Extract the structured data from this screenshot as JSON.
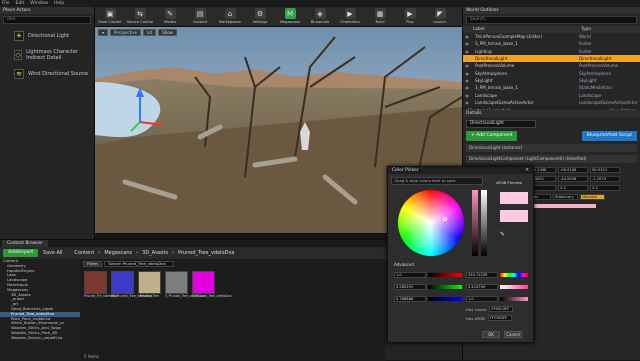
{
  "menu": {
    "file": "File",
    "edit": "Edit",
    "window": "Window",
    "help": "Help"
  },
  "place_actors": {
    "title": "Place Actors",
    "search_placeholder": "dire",
    "items": [
      "Directional Light",
      "Lightmass Character Indirect Detail",
      "Wind Directional Source"
    ]
  },
  "toolbar": {
    "items": [
      "Save Current",
      "Source Control",
      "Modes",
      "Content",
      "Marketplace",
      "Settings",
      "Megascans",
      "Blueprints",
      "Cinematics",
      "Build",
      "Play",
      "Launch"
    ]
  },
  "viewport": {
    "perspective": "Perspective",
    "lit": "Lit",
    "show": "Show"
  },
  "outliner": {
    "title": "World Outliner",
    "search_placeholder": "Search...",
    "col_label": "Label",
    "col_type": "Type",
    "rows": [
      {
        "label": "ThirdPersonExampleMap (Editor)",
        "type": "World",
        "selected": false
      },
      {
        "label": "3_PM_terrain_base_1",
        "type": "Folder",
        "selected": false
      },
      {
        "label": "Lighting",
        "type": "Folder",
        "selected": false
      },
      {
        "label": "DirectionalLight",
        "type": "DirectionalLight",
        "selected": true
      },
      {
        "label": "PostProcessVolume",
        "type": "PostProcessVolume",
        "selected": false
      },
      {
        "label": "SkyAtmosphere",
        "type": "SkyAtmosphere",
        "selected": false
      },
      {
        "label": "SkyLight",
        "type": "SkyLight",
        "selected": false
      },
      {
        "label": "3_PM_terrain_base_1",
        "type": "StaticMeshActor",
        "selected": false
      },
      {
        "label": "Landscape",
        "type": "Landscape",
        "selected": false
      },
      {
        "label": "LandscapeGizmoActiveActor",
        "type": "LandscapeGizmoActiveActor",
        "selected": false
      }
    ],
    "footer_count": "33 actors (1 selected)",
    "view_options": "View Options"
  },
  "details": {
    "title": "Details",
    "actor_name": "DirectionalLight",
    "add_component": "+ Add Component",
    "blueprint_btn": "Blueprint/Add Script",
    "component": "DirectionalLight (Instance)",
    "component2": "DirectionalLightComponent (LightComponent0) (Inherited)",
    "location": [
      "-304.2348",
      "-96.9146",
      "90.9124"
    ],
    "rotation": [
      "-66.6851",
      "-44.5946",
      "-1.2079"
    ],
    "scale": [
      "2.5",
      "2.5",
      "2.5"
    ],
    "mobility": [
      "Static",
      "Stationary",
      "Movable"
    ]
  },
  "content_browser": {
    "tab": "Content Browser",
    "add_new": "Add/Import",
    "save_all": "Save All",
    "path": [
      "Content",
      "Megascans",
      "3D_Assets",
      "Pruned_Tree_vdeloDva"
    ],
    "filters": "Filters",
    "search_placeholder": "Search Pruned_Tree_vdeloDva",
    "tree": [
      "Content",
      "Geometry",
      "HoudiniEngine",
      "Labs",
      "Landscape",
      "Mannequin",
      "Megascans",
      "3D_Assets",
      "_arood",
      "_art",
      "Dead_Branches_vlpeb",
      "Pruned_Tree_vdeloDva",
      "Rock_Pack_rcqbbt1w",
      "White_Button_Mushroom_pi",
      "Wooden_Sticks_And_Twigs",
      "Wooden_Sticks_Pack_4B",
      "Wooden_Branch_uepbfh1w"
    ],
    "assets": [
      {
        "name": "Pruned_Tre_vdeloDva",
        "color": "#7a3a32"
      },
      {
        "name": "MI_Pruned_Tree_vdeloDva",
        "color": "#3b3ac9"
      },
      {
        "name": "Pruned_Tree",
        "color": "#bfb08a"
      },
      {
        "name": "S_Pruned_Tree_vdeloDva",
        "color": "#7a7f7c"
      },
      {
        "name": "T_Pruned_Tree_vdeloDva",
        "color": "#e000e0"
      }
    ],
    "items_count": "5 items"
  },
  "color_picker": {
    "title": "Color Picker",
    "hint": "Drag & drop colors here to save",
    "srgb_preview": "sRGB Preview",
    "old": "Old",
    "new": "New",
    "advanced": "Advanced",
    "r": "1.0",
    "g": "0.585291",
    "b": "0.768886",
    "h": "334.72239",
    "s": "0.414709",
    "v": "1.0",
    "hex_linear_label": "Hex Linear",
    "hex_linear": "FF95C4FF",
    "hex_srgb_label": "Hex sRGB",
    "hex_srgb": "FFC9E2FF",
    "ok": "OK",
    "cancel": "Cancel"
  }
}
